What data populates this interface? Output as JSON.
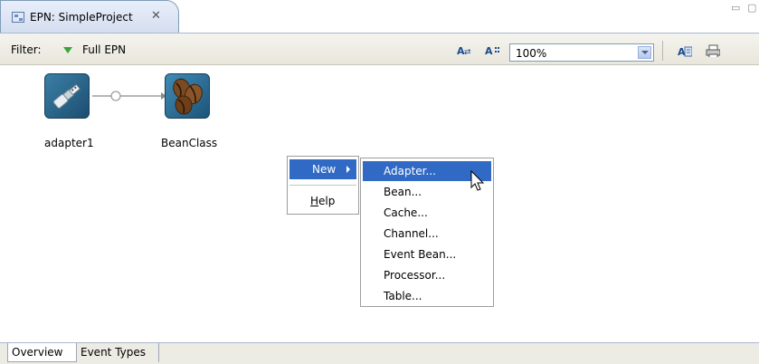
{
  "editor_tab": {
    "title": "EPN: SimpleProject",
    "close_icon": "close-icon"
  },
  "window_controls": {
    "minimize": "minimize-icon",
    "maximize": "maximize-icon"
  },
  "toolbar": {
    "filter_label": "Filter:",
    "filter_value": "Full EPN",
    "zoom": "100%",
    "icons": [
      "layout-icon",
      "grid-icon",
      "export-icon",
      "print-icon"
    ]
  },
  "nodes": [
    {
      "label": "adapter1",
      "icon": "adapter-icon"
    },
    {
      "label": "BeanClass",
      "icon": "bean-icon"
    }
  ],
  "context_menu": {
    "items": [
      {
        "label": "New",
        "highlighted": true,
        "has_submenu": true
      },
      {
        "label": "Help",
        "mnemonic": "H"
      }
    ],
    "submenu": [
      {
        "label": "Adapter...",
        "highlighted": true
      },
      {
        "label": "Bean..."
      },
      {
        "label": "Cache..."
      },
      {
        "label": "Channel..."
      },
      {
        "label": "Event Bean..."
      },
      {
        "label": "Processor..."
      },
      {
        "label": "Table..."
      }
    ]
  },
  "bottom_tabs": [
    {
      "label": "Overview",
      "active": true
    },
    {
      "label": "Event Types",
      "active": false
    }
  ],
  "colors": {
    "selection": "#316ac5",
    "toolbar_bg": "#ecebe4",
    "tab_bg": "#d5def0"
  }
}
